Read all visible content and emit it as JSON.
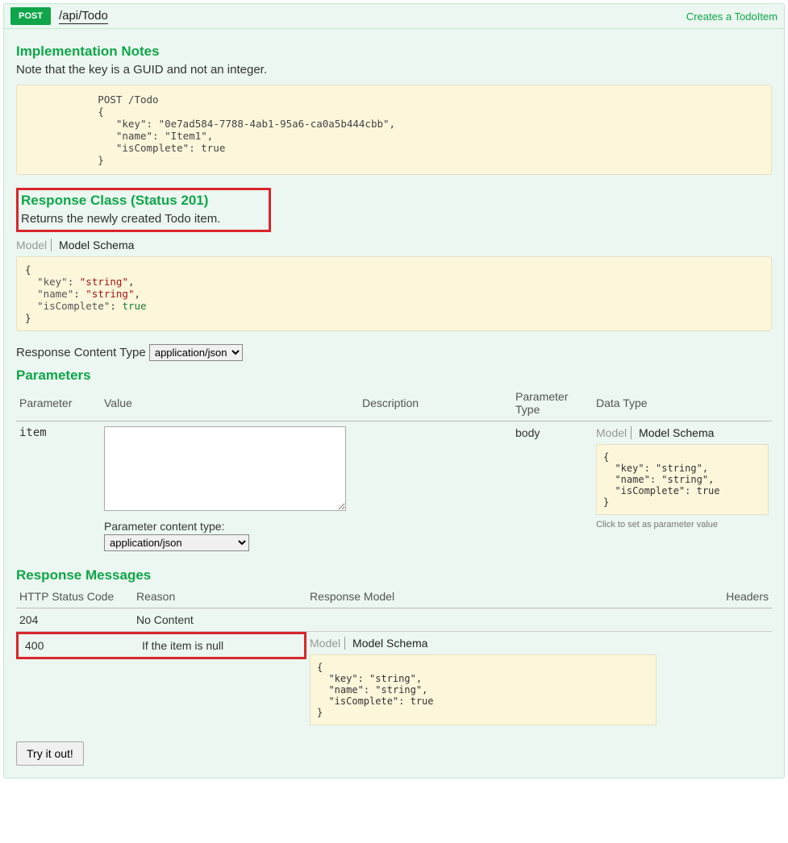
{
  "header": {
    "method": "POST",
    "path": "/api/Todo",
    "summary": "Creates a TodoItem"
  },
  "notes": {
    "heading": "Implementation Notes",
    "text": "Note that the key is a GUID and not an integer.",
    "example": "            POST /Todo\n            {\n               \"key\": \"0e7ad584-7788-4ab1-95a6-ca0a5b444cbb\",\n               \"name\": \"Item1\",\n               \"isComplete\": true\n            }"
  },
  "responseClass": {
    "heading": "Response Class (Status 201)",
    "text": "Returns the newly created Todo item.",
    "tab_model": "Model",
    "tab_schema": "Model Schema",
    "schema": "{\n  \"key\": \"string\",\n  \"name\": \"string\",\n  \"isComplete\": true\n}"
  },
  "contentType": {
    "label": "Response Content Type",
    "value": "application/json"
  },
  "parametersSection": {
    "heading": "Parameters",
    "headers": {
      "param": "Parameter",
      "value": "Value",
      "desc": "Description",
      "ptype": "Parameter Type",
      "dtype": "Data Type"
    },
    "rows": [
      {
        "name": "item",
        "value": "",
        "description": "",
        "ptype": "body",
        "tab_model": "Model",
        "tab_schema": "Model Schema",
        "schema": "{\n  \"key\": \"string\",\n  \"name\": \"string\",\n  \"isComplete\": true\n}",
        "schema_hint": "Click to set as parameter value",
        "ct_label": "Parameter content type:",
        "ct_value": "application/json"
      }
    ]
  },
  "responseMessages": {
    "heading": "Response Messages",
    "headers": {
      "code": "HTTP Status Code",
      "reason": "Reason",
      "model": "Response Model",
      "hdrs": "Headers"
    },
    "rows": [
      {
        "code": "204",
        "reason": "No Content"
      },
      {
        "code": "400",
        "reason": "If the item is null",
        "tab_model": "Model",
        "tab_schema": "Model Schema",
        "schema": "{\n  \"key\": \"string\",\n  \"name\": \"string\",\n  \"isComplete\": true\n}"
      }
    ]
  },
  "tryButton": "Try it out!"
}
